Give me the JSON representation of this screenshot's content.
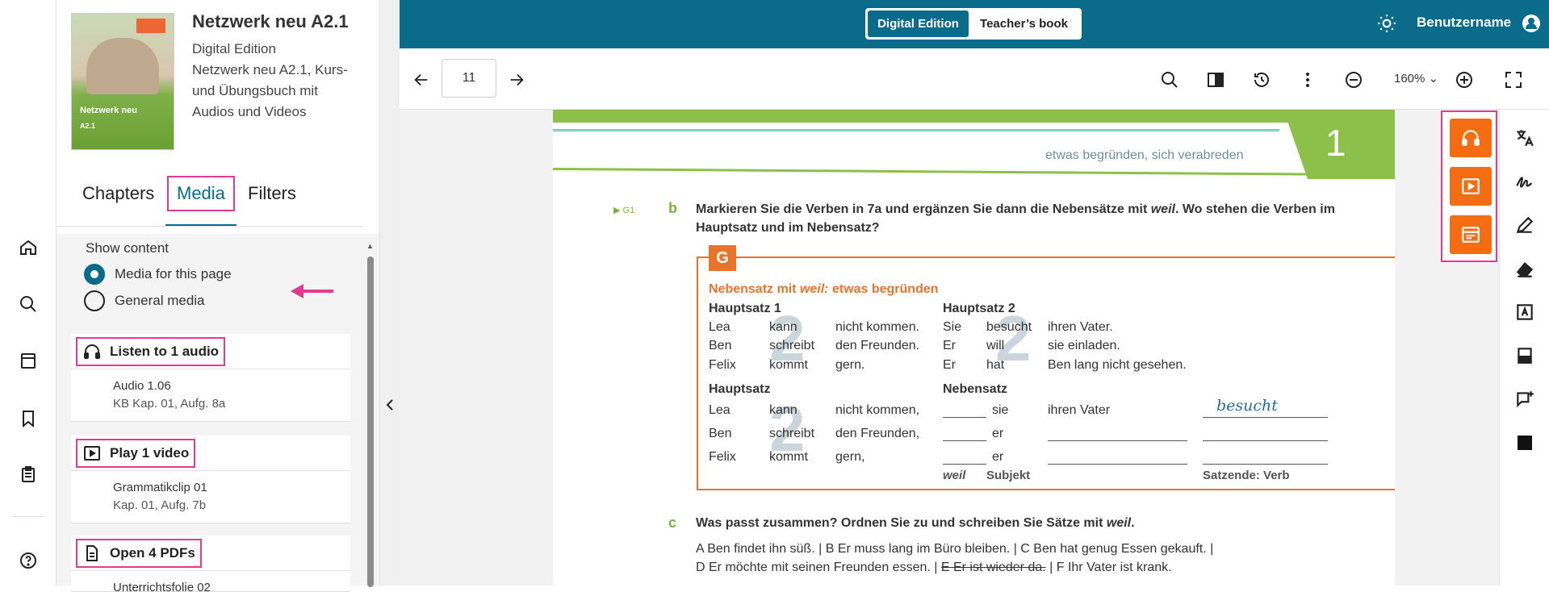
{
  "book": {
    "title": "Netzwerk neu A2.1",
    "edition": "Digital Edition",
    "description": "Netzwerk neu A2.1, Kurs- und Übungsbuch mit Audios und Videos",
    "cover_title": "Netzwerk neu",
    "cover_sub": "A2.1"
  },
  "panel_tabs": {
    "chapters": "Chapters",
    "media": "Media",
    "filters": "Filters"
  },
  "show_content": {
    "label": "Show content",
    "option_page": "Media for this page",
    "option_general": "General media"
  },
  "media_cards": [
    {
      "header": "Listen to 1 audio",
      "title": "Audio 1.06",
      "sub": "KB Kap. 01, Aufg. 8a"
    },
    {
      "header": "Play 1 video",
      "title": "Grammatikclip 01",
      "sub": "Kap. 01, Aufg. 7b"
    },
    {
      "header": "Open 4 PDFs",
      "title": "Unterrichtsfolie 02",
      "sub": ""
    }
  ],
  "header": {
    "seg_digital": "Digital Edition",
    "seg_teacher": "Teacher’s book",
    "username": "Benutzername"
  },
  "toolbar": {
    "page": "11",
    "zoom": "160%"
  },
  "page": {
    "chapter_number": "1",
    "subheader": "etwas begründen, sich verabreden",
    "ref_g1": "G1",
    "ex_b_letter": "b",
    "ex_b_line1_pre": "Markieren Sie die Verben in 7a und ergänzen Sie dann die Nebensätze mit ",
    "ex_b_weil": "weil",
    "ex_b_line1_post": ". Wo stehen die Verben im",
    "ex_b_line2": "Hauptsatz und im Nebensatz?",
    "g_tag": "G",
    "g_title_pre": "Nebensatz mit ",
    "g_title_weil": "weil:",
    "g_title_post": " etwas begründen",
    "hs1": "Hauptsatz 1",
    "hs2": "Hauptsatz 2",
    "hs": "Hauptsatz",
    "ns": "Nebensatz",
    "table1": [
      [
        "Lea",
        "kann",
        "nicht kommen.",
        "Sie",
        "besucht",
        "ihren Vater."
      ],
      [
        "Ben",
        "schreibt",
        "den Freunden.",
        "Er",
        "will",
        "sie einladen."
      ],
      [
        "Felix",
        "kommt",
        "gern.",
        "Er",
        "hat",
        "Ben lang nicht gesehen."
      ]
    ],
    "table2": [
      [
        "Lea",
        "kann",
        "nicht kommen,",
        "sie",
        "ihren Vater",
        "besucht"
      ],
      [
        "Ben",
        "schreibt",
        "den Freunden,",
        "er",
        "",
        ""
      ],
      [
        "Felix",
        "kommt",
        "gern,",
        "er",
        "",
        ""
      ]
    ],
    "bottom_weil": "weil",
    "bottom_subjekt": "Subjekt",
    "bottom_satzende": "Satzende: Verb",
    "big_num": "2",
    "ex_c_letter": "c",
    "ex_c_pre": "Was passt zusammen? Ordnen Sie zu und schreiben Sie Sätze mit ",
    "ex_c_weil": "weil",
    "ex_c_post": ".",
    "c_line1": "A Ben findet ihn süß.  |  B Er muss lang im Büro bleiben.  |  C Ben hat genug Essen gekauft.  |",
    "c_line2a": "D Er möchte mit seinen Freunden essen.  |  ",
    "c_line2b": "E Er ist wieder da.",
    "c_line2c": "  |  F Ihr Vater ist krank."
  },
  "colors": {
    "primary": "#0b6b8a",
    "accent_orange": "#f46d13",
    "highlight": "#e23a8e",
    "green": "#8cc04a"
  },
  "icons": {
    "rail": [
      "home-icon",
      "search-icon",
      "book-icon",
      "bookmark-icon",
      "clipboard-icon",
      "help-icon"
    ],
    "right": [
      "translate-icon",
      "signature-icon",
      "pen-icon",
      "eraser-icon",
      "text-box-icon",
      "note-icon",
      "comment-add-icon",
      "square-icon"
    ]
  }
}
